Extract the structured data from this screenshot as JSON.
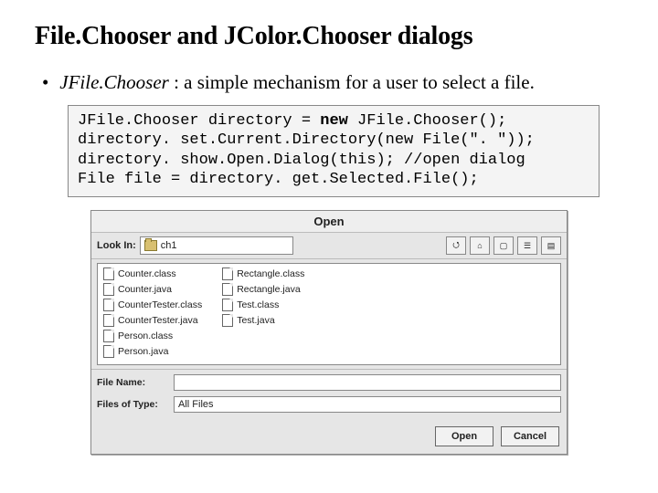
{
  "title": "File.Chooser and JColor.Chooser dialogs",
  "bullet": {
    "em": "JFile.Chooser",
    "rest": " : a simple mechanism for a user to select a file."
  },
  "code": {
    "l1a": "JFile.Chooser directory = ",
    "l1b": "new",
    "l1c": " JFile.Chooser();",
    "l2": "directory. set.Current.Directory(new File(\". \"));",
    "l3": "directory. show.Open.Dialog(this); //open dialog",
    "l4": "File file = directory. get.Selected.File();"
  },
  "dialog": {
    "title": "Open",
    "lookin_label": "Look In:",
    "lookin_value": "ch1",
    "toolbar_icons": [
      "up-one-level-icon",
      "home-icon",
      "new-folder-icon",
      "list-view-icon",
      "details-view-icon"
    ],
    "files_col1": [
      "Counter.class",
      "Counter.java",
      "CounterTester.class",
      "CounterTester.java",
      "Person.class",
      "Person.java"
    ],
    "files_col2": [
      "Rectangle.class",
      "Rectangle.java",
      "Test.class",
      "Test.java"
    ],
    "filename_label": "File Name:",
    "filename_value": "",
    "filetype_label": "Files of Type:",
    "filetype_value": "All Files",
    "open_btn": "Open",
    "cancel_btn": "Cancel"
  }
}
